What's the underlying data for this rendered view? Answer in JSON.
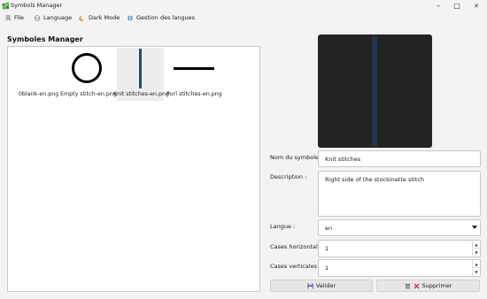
{
  "window": {
    "title": "Symbols Manager",
    "controls": {
      "minimize": "–",
      "maximize": "□",
      "close": "✕"
    }
  },
  "menu": [
    {
      "label": "File",
      "icon": "file-icon"
    },
    {
      "label": "Language",
      "icon": "language-icon"
    },
    {
      "label": "Dark Mode",
      "icon": "dark-mode-icon"
    },
    {
      "label": "Gestion des langues",
      "icon": "globe-icon"
    }
  ],
  "list": {
    "title": "Symboles Manager",
    "items": [
      {
        "name": "0blank-en.png",
        "symbol": "blank",
        "selected": false
      },
      {
        "name": "Empty stitch-en.png",
        "symbol": "circle",
        "selected": false
      },
      {
        "name": "Knit stitches-en.png",
        "symbol": "vertical-line",
        "selected": true
      },
      {
        "name": "Purl stitches-en.png",
        "symbol": "horizontal-line",
        "selected": false
      }
    ]
  },
  "form": {
    "name_label": "Nom du symbole :",
    "name_value": "Knit stitches",
    "description_label": "Description :",
    "description_value": "Right side of the stockinette stitch",
    "language_label": "Langue :",
    "language_value": "en",
    "hcells_label": "Cases horizontales :",
    "hcells_value": "1",
    "vcells_label": "Cases verticales :",
    "vcells_value": "1",
    "validate_label": "Valider",
    "delete_label": "Supprimer"
  },
  "colors": {
    "accent": "#1f4e6b",
    "preview_bg": "#232323",
    "preview_stripe": "#243650",
    "validate_icon": "#5b3fa0",
    "delete_icon": "#d13438"
  }
}
